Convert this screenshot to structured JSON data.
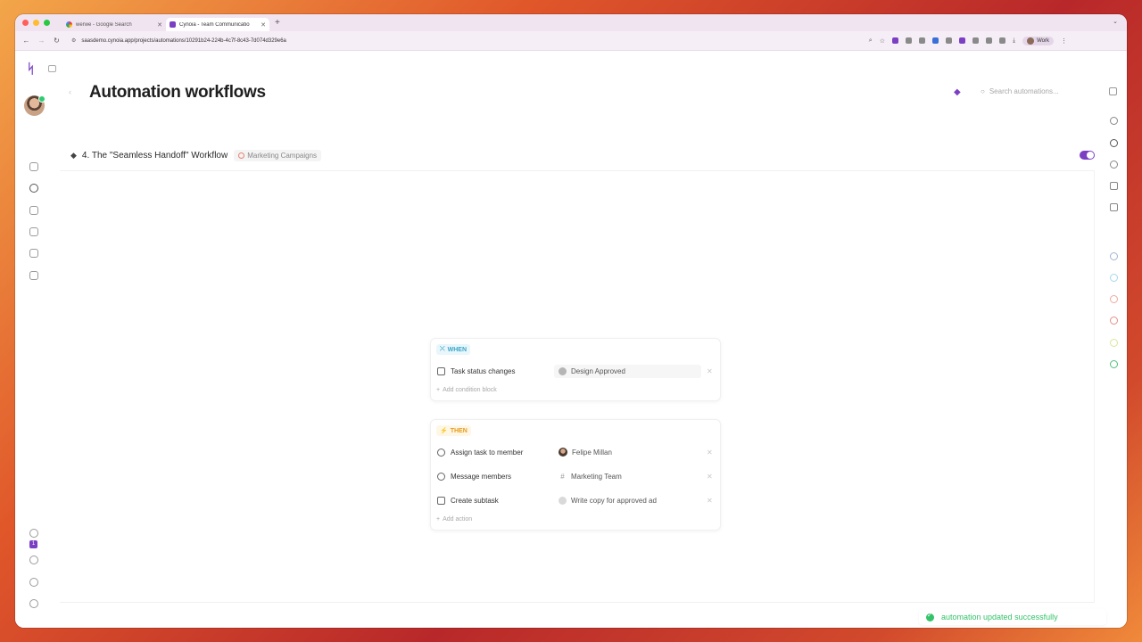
{
  "browser": {
    "tabs": [
      {
        "title": "werwe - Google Search",
        "active": false
      },
      {
        "title": "Cynoia - Team Communicatio",
        "active": true
      }
    ],
    "url": "saasdemo.cynoia.app/projects/automations/10291b24-224b-4c7f-8c43-7d074d329e6a",
    "profile_label": "Work"
  },
  "app": {
    "page_title": "Automation workflows",
    "search": {
      "placeholder": "Search automations..."
    },
    "notification_count": "1"
  },
  "workflow": {
    "title": "4. The \"Seamless Handoff\" Workflow",
    "tag": "Marketing Campaigns",
    "enabled": true,
    "when": {
      "label": "WHEN",
      "conditions": [
        {
          "action": "Task status changes",
          "value": "Design Approved",
          "icon": "status-icon"
        }
      ],
      "add_label": "Add condition block"
    },
    "then": {
      "label": "THEN",
      "actions": [
        {
          "action": "Assign task to member",
          "value": "Felipe Millan",
          "icon": "assign-icon"
        },
        {
          "action": "Message members",
          "value": "Marketing Team",
          "icon": "message-icon"
        },
        {
          "action": "Create subtask",
          "value": "Write copy for approved ad",
          "icon": "subtask-icon"
        }
      ],
      "add_label": "Add action"
    }
  },
  "toast": {
    "message": "automation updated successfully"
  },
  "colors": {
    "accent": "#7b3fc4",
    "success": "#34c26a",
    "when": "#3aa6c9",
    "then": "#e69b1a"
  }
}
